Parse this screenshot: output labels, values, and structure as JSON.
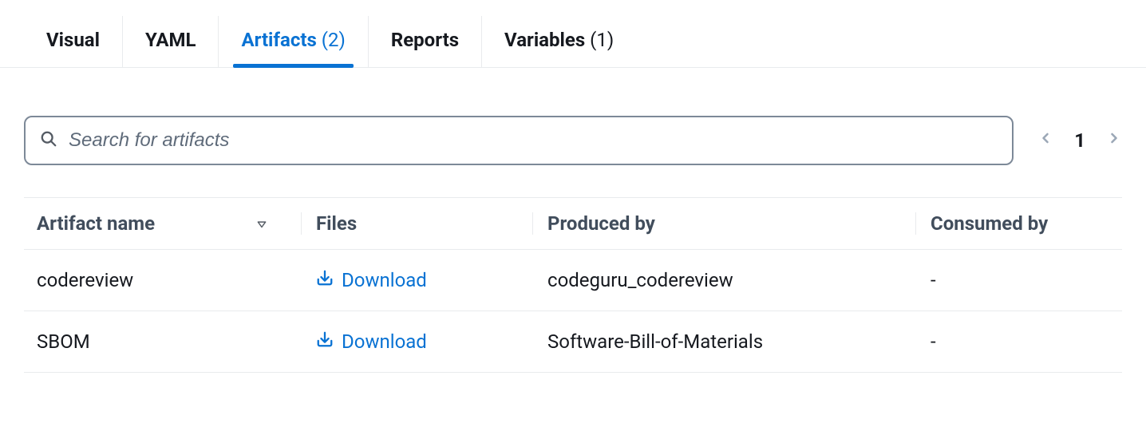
{
  "tabs": [
    {
      "label": "Visual",
      "count": null,
      "active": false
    },
    {
      "label": "YAML",
      "count": null,
      "active": false
    },
    {
      "label": "Artifacts",
      "count": "(2)",
      "active": true
    },
    {
      "label": "Reports",
      "count": null,
      "active": false
    },
    {
      "label": "Variables",
      "count": "(1)",
      "active": false
    }
  ],
  "search": {
    "placeholder": "Search for artifacts"
  },
  "pagination": {
    "current": "1"
  },
  "columns": {
    "name": "Artifact name",
    "files": "Files",
    "produced": "Produced by",
    "consumed": "Consumed by"
  },
  "download_label": "Download",
  "rows": [
    {
      "name": "codereview",
      "produced": "codeguru_codereview",
      "consumed": "-"
    },
    {
      "name": "SBOM",
      "produced": "Software-Bill-of-Materials",
      "consumed": "-"
    }
  ]
}
